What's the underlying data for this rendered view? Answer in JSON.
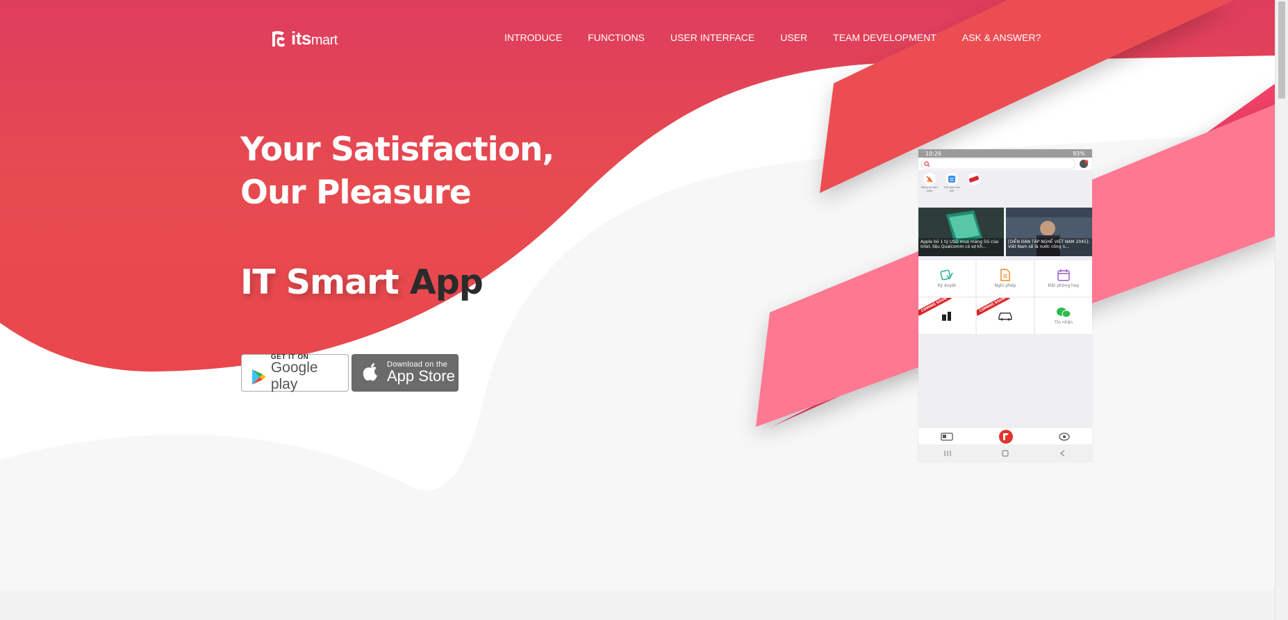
{
  "brand": {
    "logo_its": "its",
    "logo_mart": "mart",
    "primary_color": "#e5465a",
    "accent_pink": "#f03f66",
    "accent_light_pink": "#ff7892",
    "logo_icon": "itsmart-logo-icon"
  },
  "nav": {
    "items": [
      {
        "label": "INTRODUCE"
      },
      {
        "label": "FUNCTIONS"
      },
      {
        "label": "USER INTERFACE"
      },
      {
        "label": "USER"
      },
      {
        "label": "TEAM DEVELOPMENT"
      },
      {
        "label": "ASK & ANSWER?"
      }
    ]
  },
  "hero": {
    "headline": "Your Satisfaction, Our Pleasure",
    "app_title_part1": "IT Smart ",
    "app_title_part2": "App"
  },
  "stores": {
    "google_small": "GET IT ON",
    "google_big": "Google play",
    "apple_small": "Download on the",
    "apple_big": "App Store",
    "google_icon": "google-play-icon",
    "apple_icon": "apple-icon"
  },
  "phone": {
    "status_time": "10:26",
    "status_battery": "93%",
    "quick_items": [
      {
        "label": "Đăng ký nghỉ phép"
      },
      {
        "label": "Thời gian làm việc"
      }
    ],
    "news": [
      {
        "caption": "Apple bỏ 1 tỷ USD mua mảng 5G của Intel, liệu Qualcomm có sợ kh..."
      },
      {
        "caption": "[DIỄN ĐÀN TẬP NGHỀ VIỆT NAM 2045]: Việt Nam sẽ là nước công n..."
      }
    ],
    "grid": [
      {
        "label": "Ký duyệt",
        "ribbon": ""
      },
      {
        "label": "Nghỉ phép",
        "ribbon": ""
      },
      {
        "label": "Đặt phòng họp",
        "ribbon": ""
      },
      {
        "label": "",
        "ribbon": "COMING SOON"
      },
      {
        "label": "",
        "ribbon": "COMING SOON"
      },
      {
        "label": "Tin nhắn",
        "ribbon": ""
      }
    ]
  }
}
